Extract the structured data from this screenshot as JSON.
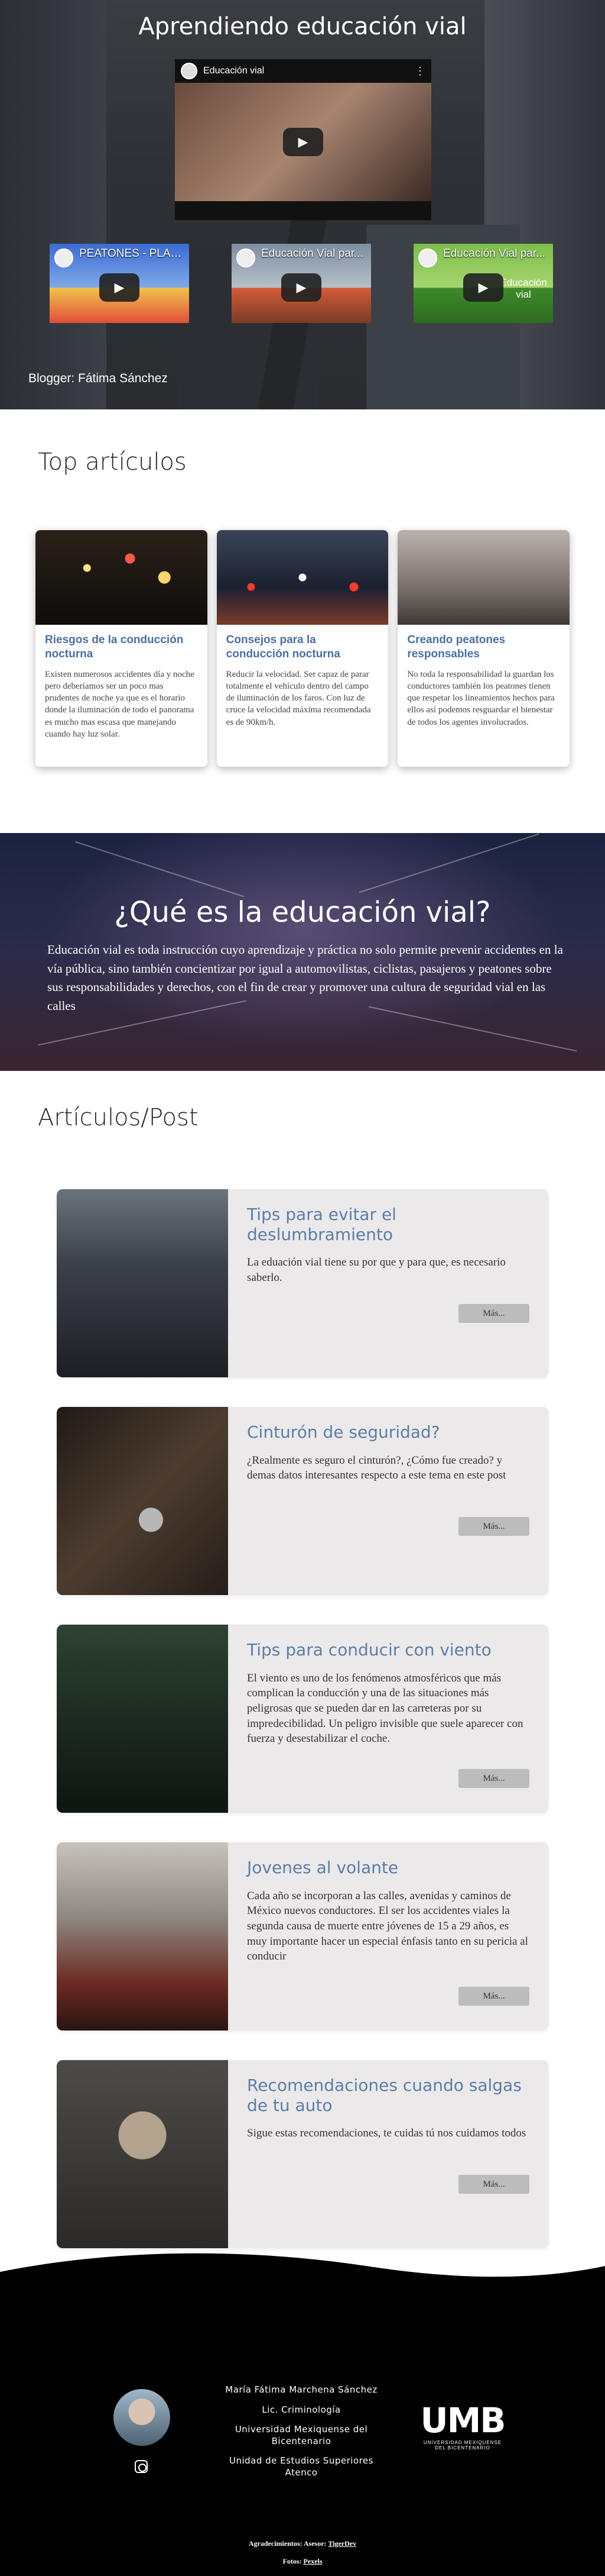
{
  "hero": {
    "title": "Aprendiendo educación vial",
    "main_video_title": "Educación vial",
    "small_videos": [
      {
        "title": "PEATONES - PLAN..."
      },
      {
        "title": "Educación Vial par..."
      },
      {
        "title": "Educación Vial par...",
        "side_text": "Educación vial"
      }
    ],
    "blogger": "Blogger: Fátima Sánchez"
  },
  "top": {
    "heading": "Top artículos",
    "cards": [
      {
        "title": "Riesgos de la conducción nocturna",
        "text": "Existen numerosos accidentes día y noche pero deberíamos ser un poco mas prudentes de noche ya que es el horario donde la iluminación de todo el panorama es mucho mas escasa que manejando cuando hay luz solar."
      },
      {
        "title": "Consejos para la conducción nocturna",
        "text": "Reducir la velocidad. Ser capaz de parar totalmente el vehículo dentro del campo de iluminación de los faros. Con luz de cruce la velocidad máxima recomendada es de 90km/h."
      },
      {
        "title": "Creando peatones responsables",
        "text": "No toda la responsabilidad la guardan los conductores también los peatones tienen que respetar los lineamientos hechos para ellos así podemos resguardar el bienestar de todos los agentes involucrados."
      }
    ]
  },
  "what": {
    "title": "¿Qué es la educación vial?",
    "text": "Educación vial es toda instrucción cuyo aprendizaje y práctica no solo permite prevenir accidentes en la vía pública, sino también concientizar por igual a automovilistas, ciclistas, pasajeros y peatones sobre sus responsabilidades y derechos, con el fin de crear y promover una cultura de seguridad vial en las calles"
  },
  "posts": {
    "heading": "Artículos/Post",
    "more_label": "Más...",
    "items": [
      {
        "title": "Tips para evitar el deslumbramiento",
        "text": "La eduación vial tiene su por que y para que, es necesario saberlo."
      },
      {
        "title": "Cinturón de seguridad?",
        "text": "¿Realmente es seguro el cinturón?, ¿Cómo fue creado? y demas datos interesantes respecto a este tema en este post"
      },
      {
        "title": "Tips para conducir con viento",
        "text": "El viento es uno de los fenómenos atmosféricos que más complican la conducción y una de las situaciones más peligrosas que se pueden dar en las carreteras por su impredecibilidad. Un peligro invisible que suele aparecer con fuerza y desestabilizar el coche."
      },
      {
        "title": "Jovenes al volante",
        "text": "Cada año se incorporan a las calles, avenidas y caminos de México nuevos conductores. El ser los accidentes viales la segunda causa de muerte entre jóvenes de 15 a 29 años, es muy importante hacer un especial énfasis tanto en su pericia al conducir"
      },
      {
        "title": "Recomendaciones cuando salgas de tu auto",
        "text": "Sigue estas recomendaciones, te cuidas tú nos cuidamos todos"
      }
    ]
  },
  "footer": {
    "name": "María Fátima Marchena Sánchez",
    "degree": "Lic. Criminología",
    "university": "Universidad Mexiquense del Bicentenario",
    "unit": "Unidad de Estudios Superiores Atenco",
    "logo_letters": "UMB",
    "logo_sub": "UNIVERSIDAD MEXIQUENSE DEL BICENTENARIO",
    "credits_prefix": "Agradecimientos: Asesor:",
    "credits_link": "TigerDev",
    "photos_prefix": "Fotos:",
    "photos_link": "Pexels"
  }
}
